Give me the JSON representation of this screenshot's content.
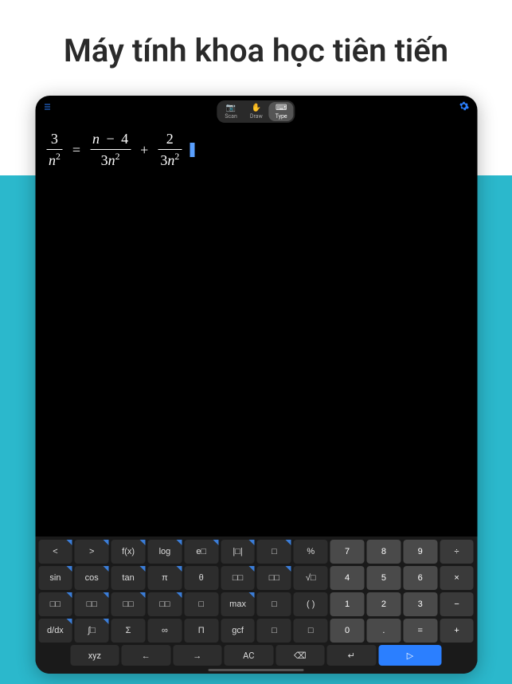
{
  "page": {
    "title": "Máy tính khoa học tiên tiến"
  },
  "modes": {
    "scan": "Scan",
    "draw": "Draw",
    "type": "Type"
  },
  "equation": {
    "f1_num": "3",
    "f1_den_n": "n",
    "f1_den_exp": "2",
    "eq": "=",
    "f2_num_n": "n",
    "f2_num_minus": "−",
    "f2_num_4": "4",
    "f2_den_3": "3",
    "f2_den_n": "n",
    "f2_den_exp": "2",
    "plus": "+",
    "f3_num": "2",
    "f3_den_3": "3",
    "f3_den_n": "n",
    "f3_den_exp": "2"
  },
  "keys": {
    "r1": [
      "<",
      ">",
      "f(x)",
      "log",
      "e□",
      "|□|",
      "□",
      "%",
      "7",
      "8",
      "9",
      "÷"
    ],
    "r2": [
      "sin",
      "cos",
      "tan",
      "π",
      "θ",
      "□□",
      "□□",
      "√□",
      "4",
      "5",
      "6",
      "×"
    ],
    "r3": [
      "□□",
      "□□",
      "□□",
      "□□",
      "□",
      "max",
      "□",
      "( )",
      "1",
      "2",
      "3",
      "−"
    ],
    "r4": [
      "d/dx",
      "∫□",
      "Σ",
      "∞",
      "Π",
      "gcf",
      "□",
      "□",
      "0",
      ".",
      "=",
      "+"
    ]
  },
  "bottom": {
    "xyz": "xyz",
    "left": "←",
    "right": "→",
    "ac": "AC",
    "back": "⌫",
    "enter": "↵",
    "send": "▷"
  }
}
